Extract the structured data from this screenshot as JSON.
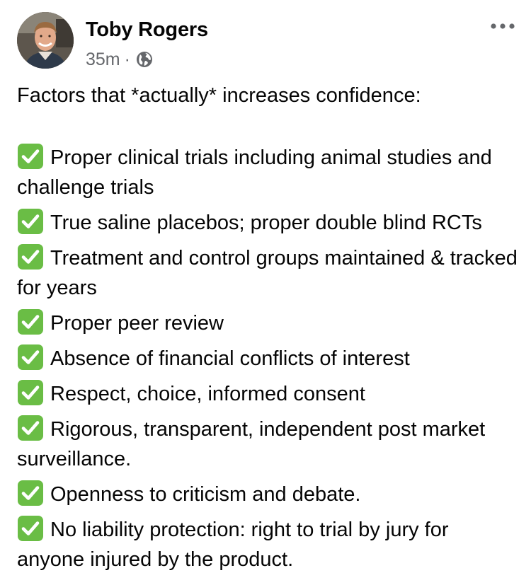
{
  "post": {
    "author": "Toby Rogers",
    "time": "35m",
    "separator": "·",
    "audience_icon": "globe-icon",
    "more_icon": "more-options-icon",
    "intro": "Factors that *actually* increases confidence:",
    "check_icon": "check-mark-button-emoji",
    "check_color": "#6abd45",
    "items": [
      "Proper clinical trials including animal studies and challenge trials",
      "True saline placebos; proper double blind RCTs",
      "Treatment and control groups maintained & tracked for years",
      "Proper peer review",
      "Absence of financial conflicts of interest",
      "Respect, choice, informed consent",
      "Rigorous, transparent, independent post market surveillance.",
      "Openness to criticism and debate.",
      "No liability protection: right to trial by jury for anyone injured by the product."
    ]
  }
}
